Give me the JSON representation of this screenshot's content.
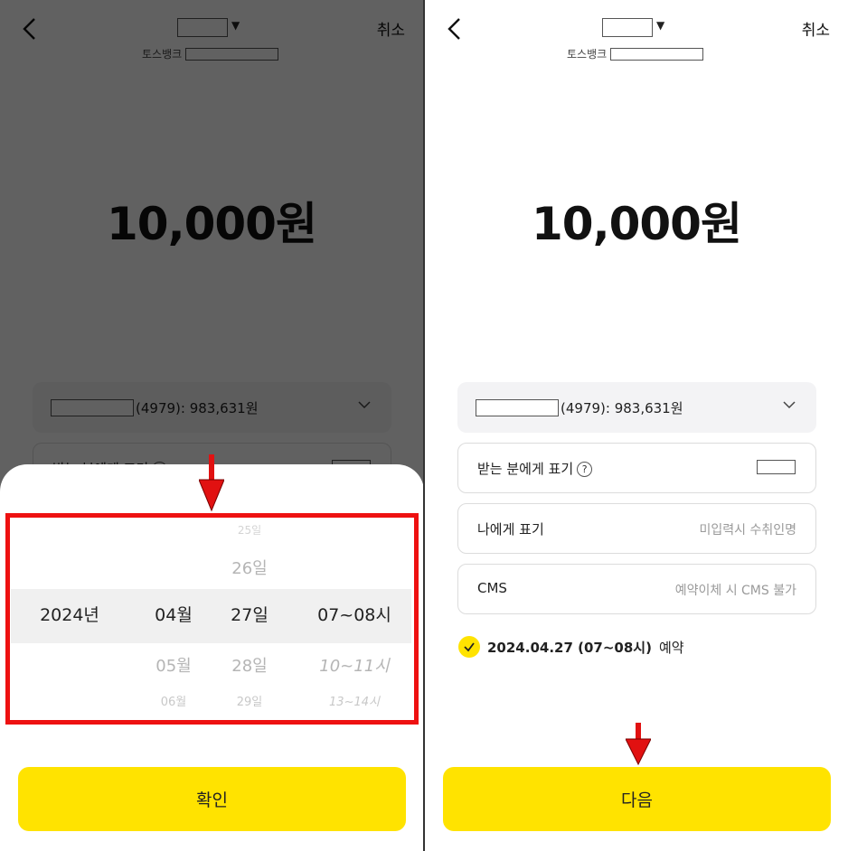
{
  "header": {
    "cancel_label": "취소",
    "bank_name": "토스뱅크"
  },
  "amount": "10,000원",
  "account": {
    "summary": "(4979): 983,631원"
  },
  "fields": {
    "recipient_label": "받는 분에게 표기",
    "help_glyph": "?",
    "me_label": "나에게 표기",
    "me_placeholder": "미입력시 수취인명",
    "cms_label": "CMS",
    "cms_placeholder": "예약이체 시 CMS 불가"
  },
  "picker": {
    "year": "2024년",
    "month": {
      "selected": "04월",
      "next": "05월",
      "next2": "06월"
    },
    "day": {
      "prev2": "25일",
      "prev": "26일",
      "selected": "27일",
      "next": "28일",
      "next2": "29일"
    },
    "hour": {
      "selected": "07~08시",
      "next": "10~11시",
      "next2": "13~14시"
    }
  },
  "buttons": {
    "confirm": "확인",
    "next": "다음"
  },
  "reservation": {
    "date": "2024.04.27 (07~08시)",
    "suffix": "예약"
  },
  "colors": {
    "accent_yellow": "#ffe300",
    "annotation_red": "#e11111"
  }
}
